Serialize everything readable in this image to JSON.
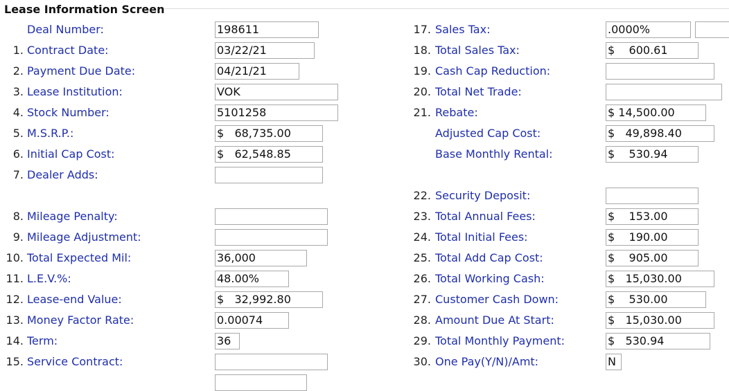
{
  "screen_title": "Lease Information Screen",
  "left": [
    {
      "num": "",
      "label": "Deal Number:",
      "value": "198611"
    },
    {
      "num": "1.",
      "label": "Contract Date:",
      "value": "03/22/21"
    },
    {
      "num": "2.",
      "label": "Payment Due Date:",
      "value": "04/21/21"
    },
    {
      "num": "3.",
      "label": "Lease Institution:",
      "value": "VOK"
    },
    {
      "num": "4.",
      "label": "Stock Number:",
      "value": "5101258"
    },
    {
      "num": "5.",
      "label": "M.S.R.P.:",
      "value": "$   68,735.00"
    },
    {
      "num": "6.",
      "label": "Initial Cap Cost:",
      "value": "$   62,548.85"
    },
    {
      "num": "7.",
      "label": "Dealer Adds:",
      "value": ""
    },
    {
      "num": "8.",
      "label": "Mileage Penalty:",
      "value": ""
    },
    {
      "num": "9.",
      "label": "Mileage Adjustment:",
      "value": ""
    },
    {
      "num": "10.",
      "label": "Total Expected Mil:",
      "value": "36,000"
    },
    {
      "num": "11.",
      "label": "L.E.V.%:",
      "value": "48.00%"
    },
    {
      "num": "12.",
      "label": "Lease-end Value:",
      "value": "$   32,992.80"
    },
    {
      "num": "13.",
      "label": "Money Factor Rate:",
      "value": "0.00074"
    },
    {
      "num": "14.",
      "label": "Term:",
      "value": "36"
    },
    {
      "num": "15.",
      "label": "Service Contract:",
      "value": ""
    },
    {
      "num": "",
      "label": "",
      "value": ""
    }
  ],
  "right": [
    {
      "num": "17.",
      "label": "Sales Tax:",
      "value": ".0000%",
      "value2": ""
    },
    {
      "num": "18.",
      "label": "Total Sales Tax:",
      "value": "$    600.61"
    },
    {
      "num": "19.",
      "label": "Cash Cap Reduction:",
      "value": ""
    },
    {
      "num": "20.",
      "label": "Total Net Trade:",
      "value": ""
    },
    {
      "num": "21.",
      "label": "Rebate:",
      "value": "$ 14,500.00"
    },
    {
      "num": "",
      "label": "Adjusted Cap Cost:",
      "value": "$   49,898.40"
    },
    {
      "num": "",
      "label": "Base Monthly Rental:",
      "value": "$    530.94"
    },
    {
      "num": "22.",
      "label": "Security Deposit:",
      "value": ""
    },
    {
      "num": "23.",
      "label": "Total Annual Fees:",
      "value": "$    153.00"
    },
    {
      "num": "24.",
      "label": "Total Initial Fees:",
      "value": "$    190.00"
    },
    {
      "num": "25.",
      "label": "Total Add Cap Cost:",
      "value": "$    905.00"
    },
    {
      "num": "26.",
      "label": "Total Working Cash:",
      "value": "$   15,030.00"
    },
    {
      "num": "27.",
      "label": "Customer Cash Down:",
      "value": "$    530.00"
    },
    {
      "num": "28.",
      "label": "Amount Due At Start:",
      "value": "$   15,030.00"
    },
    {
      "num": "29.",
      "label": "Total Monthly Payment:",
      "value": "$   530.94"
    },
    {
      "num": "30.",
      "label": "One Pay(Y/N)/Amt:",
      "value": "N"
    }
  ]
}
